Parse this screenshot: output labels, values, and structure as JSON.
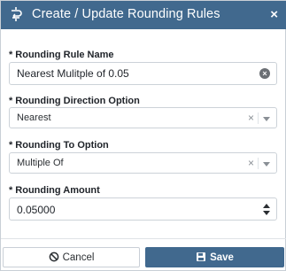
{
  "dialog": {
    "title": "Create / Update Rounding Rules",
    "close_label": "×",
    "header_color": "#41698e"
  },
  "fields": {
    "rule_name": {
      "required_marker": "*",
      "label": "Rounding Rule Name",
      "value": "Nearest Mulitple of 0.05"
    },
    "direction": {
      "required_marker": "*",
      "label": "Rounding Direction Option",
      "value": "Nearest",
      "clear_label": "×"
    },
    "rounding_to": {
      "required_marker": "*",
      "label": "Rounding To Option",
      "value": "Multiple Of",
      "clear_label": "×"
    },
    "amount": {
      "required_marker": "*",
      "label": "Rounding Amount",
      "value": "0.05000"
    }
  },
  "footer": {
    "cancel_label": "Cancel",
    "save_label": "Save",
    "cancel_icon": "ban-icon",
    "save_icon": "floppy-disk-icon"
  }
}
